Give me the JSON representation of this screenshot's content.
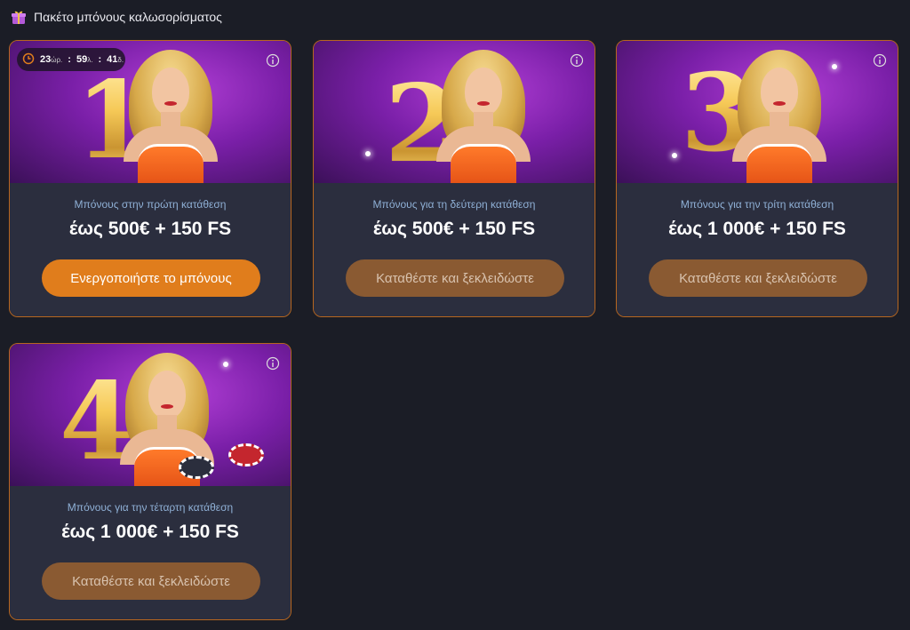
{
  "header": {
    "title": "Πακέτο μπόνους καλωσορίσματος",
    "icon": "gift-icon"
  },
  "cards": [
    {
      "digit": "1",
      "subtitle": "Μπόνους στην πρώτη κατάθεση",
      "amount": "έως 500€ + 150 FS",
      "button": "Ενεργοποιήστε το μπόνους",
      "timer": {
        "hours": "23",
        "hours_unit": "ώρ.",
        "minutes": "59",
        "minutes_unit": "λ.",
        "seconds": "41",
        "seconds_unit": "δ."
      }
    },
    {
      "digit": "2",
      "subtitle": "Μπόνους για τη δεύτερη κατάθεση",
      "amount": "έως 500€ + 150 FS",
      "button": "Καταθέστε και ξεκλειδώστε"
    },
    {
      "digit": "3",
      "subtitle": "Μπόνους για την τρίτη κατάθεση",
      "amount": "έως 1 000€ + 150 FS",
      "button": "Καταθέστε και ξεκλειδώστε"
    },
    {
      "digit": "4",
      "subtitle": "Μπόνους για την τέταρτη κατάθεση",
      "amount": "έως 1 000€ + 150 FS",
      "button": "Καταθέστε και ξεκλειδώστε"
    }
  ],
  "colors": {
    "background": "#1b1d26",
    "card_border": "#b7661f",
    "active_button": "#e07d1c",
    "locked_button": "#8a5a32",
    "subtitle": "#8fb0d6"
  }
}
